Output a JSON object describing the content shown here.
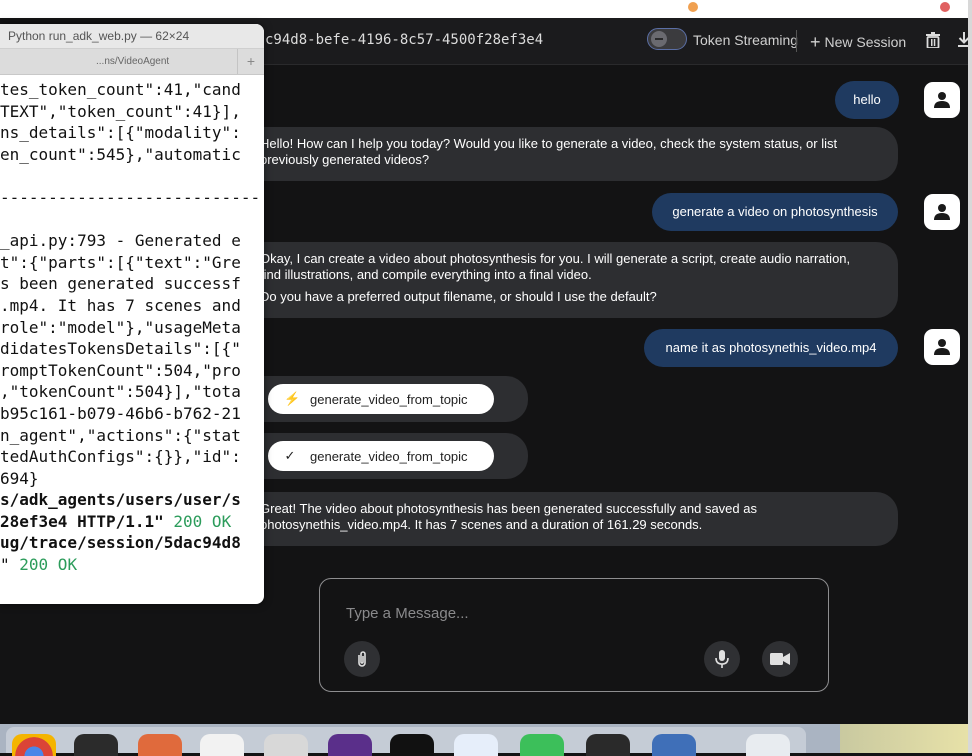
{
  "terminal": {
    "title": "Python run_adk_web.py — 62×24",
    "tab_label": "...ns/VideoAgent",
    "new_tab_label": "+",
    "lines": [
      {
        "text": "tes_token_count\":41,\"cand",
        "style": "normal"
      },
      {
        "text": "TEXT\",\"token_count\":41}],",
        "style": "normal"
      },
      {
        "text": "ns_details\":[{\"modality\":",
        "style": "normal"
      },
      {
        "text": "en_count\":545},\"automatic",
        "style": "normal"
      },
      {
        "text": "",
        "style": "normal"
      },
      {
        "text": "---------------------------",
        "style": "normal"
      },
      {
        "text": "",
        "style": "normal"
      },
      {
        "text": "_api.py:793 - Generated e",
        "style": "normal"
      },
      {
        "text": "t\":{\"parts\":[{\"text\":\"Gre",
        "style": "normal"
      },
      {
        "text": "s been generated successf",
        "style": "normal"
      },
      {
        "text": ".mp4. It has 7 scenes and",
        "style": "normal"
      },
      {
        "text": "role\":\"model\"},\"usageMeta",
        "style": "normal"
      },
      {
        "text": "didatesTokensDetails\":[{\"",
        "style": "normal"
      },
      {
        "text": "romptTokenCount\":504,\"pro",
        "style": "normal"
      },
      {
        "text": ",\"tokenCount\":504}],\"tota",
        "style": "normal"
      },
      {
        "text": "b95c161-b079-46b6-b762-21",
        "style": "normal"
      },
      {
        "text": "n_agent\",\"actions\":{\"stat",
        "style": "normal"
      },
      {
        "text": "tedAuthConfigs\":{}},\"id\":",
        "style": "normal"
      },
      {
        "text": "694}",
        "style": "normal"
      },
      {
        "text": "s/adk_agents/users/user/s",
        "style": "bold"
      },
      {
        "text": "28ef3e4 HTTP/1.1\"",
        "style": "bold",
        "ok": " 200 OK"
      },
      {
        "text": "ug/trace/session/5dac94d8",
        "style": "bold"
      },
      {
        "text": "\"",
        "style": "normal",
        "ok": " 200 OK"
      }
    ]
  },
  "header": {
    "session_id": "c94d8-befe-4196-8c57-4500f28ef3e4",
    "token_streaming_label": "Token Streaming",
    "new_session_label": "New Session"
  },
  "messages": {
    "user1": "hello",
    "bot1": "Hello! How can I help you today? Would you like to generate a video, check the system status, or list previously generated videos?",
    "user2": "generate a video on photosynthesis",
    "bot2_p1": "Okay, I can create a video about photosynthesis for you. I will generate a script, create audio narration, find illustrations, and compile everything into a final video.",
    "bot2_p2": "Do you have a preferred output filename, or should I use the default?",
    "user3": "name it as photosynethis_video.mp4",
    "tool_call": "generate_video_from_topic",
    "tool_result": "generate_video_from_topic",
    "bot3": "Great! The video about photosynthesis has been generated successfully and saved as photosynethis_video.mp4. It has 7 scenes and a duration of 161.29 seconds."
  },
  "input": {
    "placeholder": "Type a Message..."
  },
  "colors": {
    "user_bubble": "#1f3a60",
    "bot_bubble": "#2d2e31",
    "background": "#131314",
    "status_ok": "#2c9c5b"
  },
  "icons": {
    "tool_call": "lightning-icon",
    "tool_result": "checkmark-icon",
    "attach": "paperclip-icon",
    "mic": "microphone-icon",
    "video": "video-camera-icon",
    "trash": "trash-icon",
    "download": "download-icon",
    "avatar": "user-avatar-icon"
  }
}
